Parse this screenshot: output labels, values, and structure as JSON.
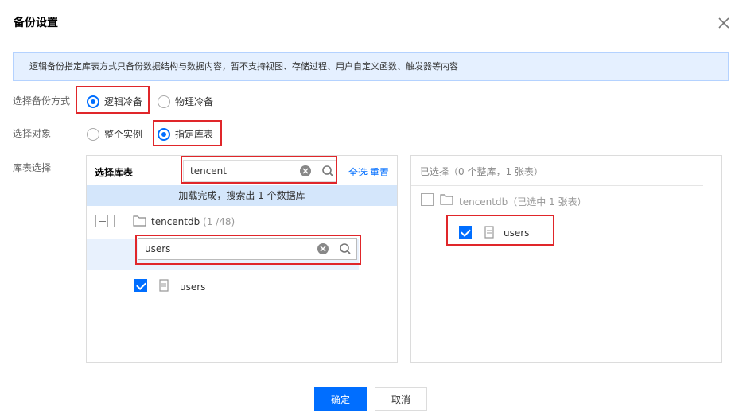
{
  "dialog": {
    "title": "备份设置"
  },
  "notice": {
    "text": "逻辑备份指定库表方式只备份数据结构与数据内容，暂不支持视图、存储过程、用户自定义函数、触发器等内容"
  },
  "backup_mode": {
    "label": "选择备份方式",
    "options": [
      {
        "label": "逻辑冷备",
        "checked": true
      },
      {
        "label": "物理冷备",
        "checked": false
      }
    ]
  },
  "backup_object": {
    "label": "选择对象",
    "options": [
      {
        "label": "整个实例",
        "checked": false
      },
      {
        "label": "指定库表",
        "checked": true
      }
    ]
  },
  "table_select": {
    "label": "库表选择",
    "left": {
      "title": "选择库表",
      "search_value": "tencent",
      "select_all": "全选",
      "reset": "重置",
      "status": "加载完成，搜索出 1 个数据库",
      "db_name": "tencentdb",
      "db_count": "(1 /48)",
      "table_search_value": "users",
      "table_name": "users"
    },
    "right": {
      "title": "已选择（0 个整库，1 张表）",
      "db_label": "tencentdb（已选中 1 张表）",
      "table_name": "users"
    }
  },
  "footer": {
    "confirm": "确定",
    "cancel": "取消"
  },
  "colors": {
    "accent": "#006eff",
    "highlight_border": "#e0262a",
    "notice_bg": "#e5f0ff"
  }
}
